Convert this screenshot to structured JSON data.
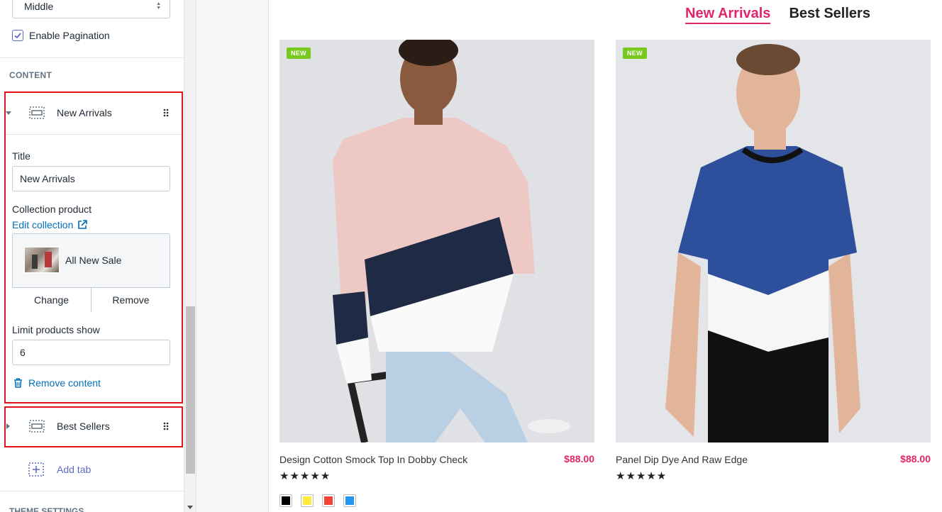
{
  "sidebar": {
    "layout_select": {
      "value": "Middle"
    },
    "enable_pagination": {
      "label": "Enable Pagination",
      "checked": true
    },
    "content_section_label": "CONTENT",
    "blocks": [
      {
        "label": "New Arrivals",
        "expanded": true,
        "title_label": "Title",
        "title_value": "New Arrivals",
        "collection_label": "Collection product",
        "edit_collection_label": "Edit collection",
        "collection_name": "All New Sale",
        "change_label": "Change",
        "remove_label": "Remove",
        "limit_label": "Limit products show",
        "limit_value": "6",
        "remove_content_label": "Remove content"
      },
      {
        "label": "Best Sellers",
        "expanded": false
      }
    ],
    "add_tab_label": "Add tab",
    "theme_settings_label": "THEME SETTINGS"
  },
  "preview": {
    "tabs": [
      {
        "label": "New Arrivals",
        "active": true
      },
      {
        "label": "Best Sellers",
        "active": false
      }
    ],
    "products": [
      {
        "badge": "NEW",
        "name": "Design Cotton Smock Top In Dobby Check",
        "price": "$88.00",
        "rating": 5,
        "stars": "★★★★★",
        "swatches": [
          "#000000",
          "#ffeb3b",
          "#f44336",
          "#2196f3"
        ]
      },
      {
        "badge": "NEW",
        "name": "Panel Dip Dye And Raw Edge",
        "price": "$88.00",
        "rating": 5,
        "stars": "★★★★★"
      }
    ]
  },
  "colors": {
    "accent_pink": "#e0256b",
    "badge_green": "#78c91e",
    "link_blue": "#006fbb",
    "highlight_red": "#e0161d",
    "add_tab_purple": "#5c6ac4"
  }
}
